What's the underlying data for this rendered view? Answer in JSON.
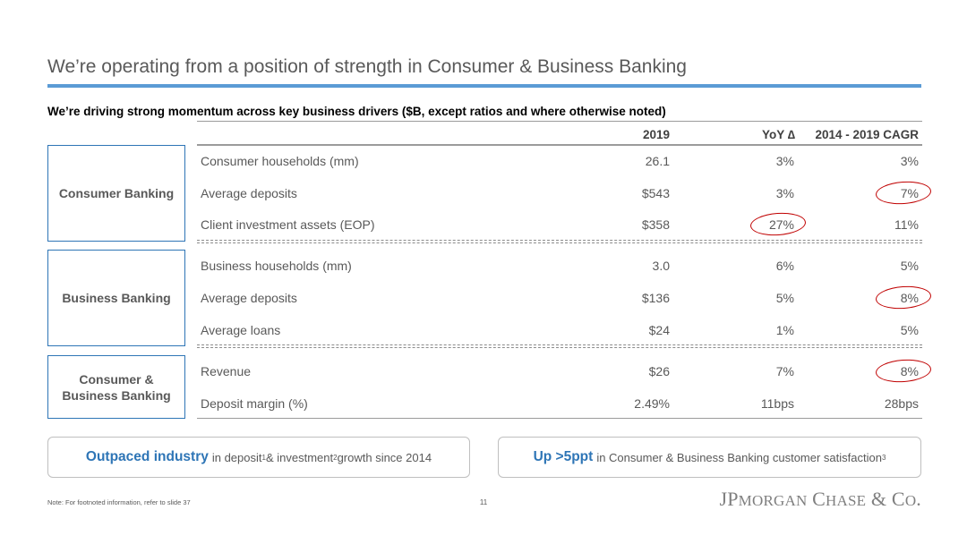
{
  "title": "We’re operating from a position of strength in Consumer & Business Banking",
  "subtitle": "We’re driving strong momentum across key business drivers ($B, except ratios and where otherwise noted)",
  "columns": {
    "y2019": "2019",
    "yoy": "YoY ∆",
    "cagr": "2014 - 2019 CAGR"
  },
  "segments": [
    {
      "name": "Consumer Banking",
      "rows": [
        {
          "label": "Consumer households (mm)",
          "v2019": "26.1",
          "yoy": "3%",
          "cagr": "3%"
        },
        {
          "label": "Average deposits",
          "v2019": "$543",
          "yoy": "3%",
          "cagr": "7%"
        },
        {
          "label": "Client investment assets (EOP)",
          "v2019": "$358",
          "yoy": "27%",
          "cagr": "11%"
        }
      ]
    },
    {
      "name": "Business Banking",
      "rows": [
        {
          "label": "Business households (mm)",
          "v2019": "3.0",
          "yoy": "6%",
          "cagr": "5%"
        },
        {
          "label": "Average deposits",
          "v2019": "$136",
          "yoy": "5%",
          "cagr": "8%"
        },
        {
          "label": "Average loans",
          "v2019": "$24",
          "yoy": "1%",
          "cagr": "5%"
        }
      ]
    },
    {
      "name_line1": "Consumer &",
      "name_line2": "Business Banking",
      "rows": [
        {
          "label": "Revenue",
          "v2019": "$26",
          "yoy": "7%",
          "cagr": "8%"
        },
        {
          "label": "Deposit margin (%)",
          "v2019": "2.49%",
          "yoy": "11bps",
          "cagr": "28bps"
        }
      ]
    }
  ],
  "callouts": [
    {
      "strong": "Outpaced industry",
      "text_a": "in deposit",
      "sup_a": "1",
      "text_b": " & investment",
      "sup_b": "2",
      "text_c": " growth since 2014"
    },
    {
      "strong": "Up >5ppt",
      "text_a": "in Consumer & Business Banking customer satisfaction",
      "sup_a": "3"
    }
  ],
  "footer": {
    "note": "Note: For footnoted information, refer to slide 37",
    "page": "11",
    "logo_parts": [
      "JP",
      "MORGAN",
      " C",
      "HASE",
      " & C",
      "O",
      "."
    ]
  },
  "colors": {
    "accent": "#5b9bd5",
    "box_border": "#2e75b6",
    "highlight_circle": "#c00000"
  }
}
